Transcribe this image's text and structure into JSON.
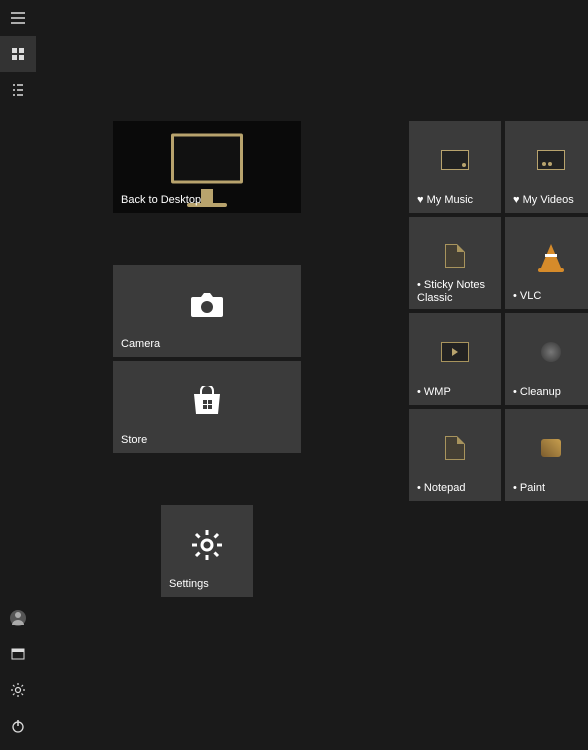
{
  "sidebar": {
    "top": [
      {
        "name": "hamburger-icon"
      },
      {
        "name": "pinned-tiles-icon"
      },
      {
        "name": "all-apps-icon"
      }
    ],
    "bottom": [
      {
        "name": "user-icon"
      },
      {
        "name": "file-explorer-icon"
      },
      {
        "name": "settings-icon"
      },
      {
        "name": "power-icon"
      }
    ]
  },
  "tiles": {
    "back_to_desktop": {
      "label": "Back to Desktop"
    },
    "camera": {
      "label": "Camera"
    },
    "store": {
      "label": "Store"
    },
    "settings": {
      "label": "Settings"
    }
  },
  "right_tiles": [
    {
      "label": "My Music",
      "prefix": "♥"
    },
    {
      "label": "My Videos",
      "prefix": "♥"
    },
    {
      "label": "Sticky Notes Classic",
      "prefix": "•"
    },
    {
      "label": "VLC",
      "prefix": "•"
    },
    {
      "label": "WMP",
      "prefix": "•"
    },
    {
      "label": "Cleanup",
      "prefix": "•"
    },
    {
      "label": "Notepad",
      "prefix": "•"
    },
    {
      "label": "Paint",
      "prefix": "•"
    }
  ]
}
